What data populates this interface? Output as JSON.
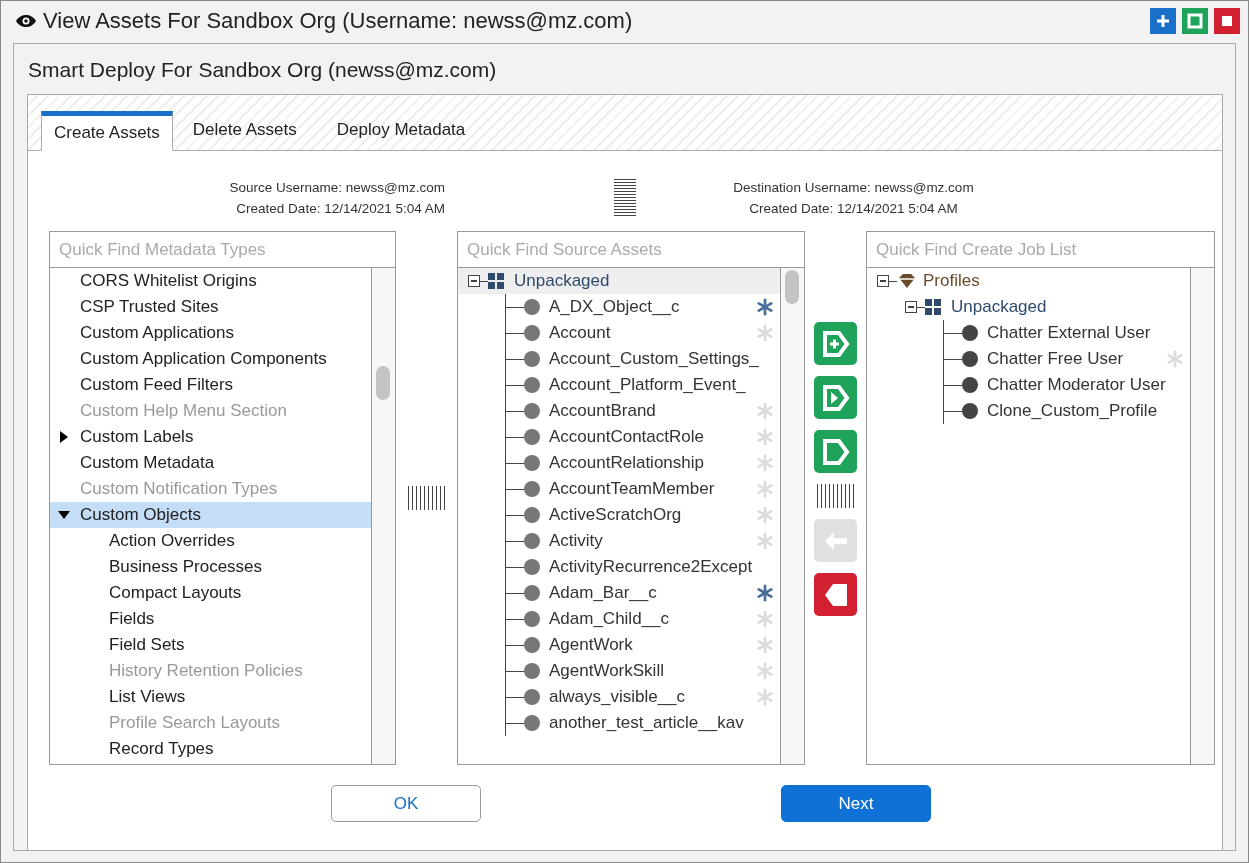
{
  "window": {
    "title": "View Assets For Sandbox Org (Username: newss@mz.com)"
  },
  "dialog": {
    "title": "Smart Deploy For Sandbox Org (newss@mz.com)"
  },
  "tabs": [
    {
      "label": "Create Assets",
      "selected": true
    },
    {
      "label": "Delete Assets",
      "selected": false
    },
    {
      "label": "Deploy Metadata",
      "selected": false
    }
  ],
  "source_info": {
    "username": "Source Username: newss@mz.com",
    "created": "Created Date: 12/14/2021 5:04 AM"
  },
  "destination_info": {
    "username": "Destination Username: newss@mz.com",
    "created": "Created Date: 12/14/2021 5:04 AM"
  },
  "metadata_types": {
    "placeholder": "Quick Find Metadata Types",
    "items": [
      {
        "label": "CORS Whitelist Origins",
        "disabled": false,
        "selected": false
      },
      {
        "label": "CSP Trusted Sites",
        "disabled": false,
        "selected": false
      },
      {
        "label": "Custom Applications",
        "disabled": false,
        "selected": false
      },
      {
        "label": "Custom Application Components",
        "disabled": false,
        "selected": false
      },
      {
        "label": "Custom Feed Filters",
        "disabled": false,
        "selected": false
      },
      {
        "label": "Custom Help Menu Section",
        "disabled": true,
        "selected": false
      },
      {
        "label": "Custom Labels",
        "disabled": false,
        "selected": false,
        "expanded": false
      },
      {
        "label": "Custom Metadata",
        "disabled": false,
        "selected": false
      },
      {
        "label": "Custom Notification Types",
        "disabled": true,
        "selected": false
      },
      {
        "label": "Custom Objects",
        "disabled": false,
        "selected": true,
        "expanded": true,
        "children": [
          {
            "label": "Action Overrides",
            "disabled": false,
            "selected": false
          },
          {
            "label": "Business Processes",
            "disabled": false,
            "selected": false
          },
          {
            "label": "Compact Layouts",
            "disabled": false,
            "selected": false
          },
          {
            "label": "Fields",
            "disabled": false,
            "selected": false
          },
          {
            "label": "Field Sets",
            "disabled": false,
            "selected": false
          },
          {
            "label": "History Retention Policies",
            "disabled": true,
            "selected": false
          },
          {
            "label": "List Views",
            "disabled": false,
            "selected": false
          },
          {
            "label": "Profile Search Layouts",
            "disabled": true,
            "selected": false
          },
          {
            "label": "Record Types",
            "disabled": false,
            "selected": false
          }
        ]
      }
    ]
  },
  "source_assets": {
    "placeholder": "Quick Find Source Assets",
    "root": {
      "label": "Unpackaged",
      "expanded": true,
      "selected": true,
      "children": [
        {
          "label": "A_DX_Object__c",
          "starred": true
        },
        {
          "label": "Account",
          "starred": false
        },
        {
          "label": "Account_Custom_Settings_"
        },
        {
          "label": "Account_Platform_Event_"
        },
        {
          "label": "AccountBrand",
          "starred": false
        },
        {
          "label": "AccountContactRole",
          "starred": false
        },
        {
          "label": "AccountRelationship",
          "starred": false
        },
        {
          "label": "AccountTeamMember",
          "starred": false
        },
        {
          "label": "ActiveScratchOrg",
          "starred": false
        },
        {
          "label": "Activity",
          "starred": false
        },
        {
          "label": "ActivityRecurrence2Except"
        },
        {
          "label": "Adam_Bar__c",
          "starred": true
        },
        {
          "label": "Adam_Child__c",
          "starred": false
        },
        {
          "label": "AgentWork",
          "starred": false
        },
        {
          "label": "AgentWorkSkill",
          "starred": false
        },
        {
          "label": "always_visible__c",
          "starred": false
        },
        {
          "label": "another_test_article__kav"
        }
      ]
    }
  },
  "transfer_buttons": [
    {
      "kind": "add",
      "disabled": false
    },
    {
      "kind": "add-one",
      "disabled": false
    },
    {
      "kind": "add-all",
      "disabled": false
    },
    {
      "kind": "grip"
    },
    {
      "kind": "remove",
      "disabled": true
    },
    {
      "kind": "remove-all",
      "disabled": false
    }
  ],
  "job_list": {
    "placeholder": "Quick Find Create Job List",
    "root": {
      "label": "Profiles",
      "expanded": true,
      "children": [
        {
          "label": "Unpackaged",
          "expanded": true,
          "children": [
            {
              "label": "Chatter External User"
            },
            {
              "label": "Chatter Free User",
              "starred": false
            },
            {
              "label": "Chatter Moderator User"
            },
            {
              "label": "Clone_Custom_Profile"
            }
          ]
        }
      ]
    }
  },
  "buttons": [
    {
      "label": "OK",
      "kind": "secondary"
    },
    {
      "label": "Next",
      "kind": "primary"
    }
  ]
}
